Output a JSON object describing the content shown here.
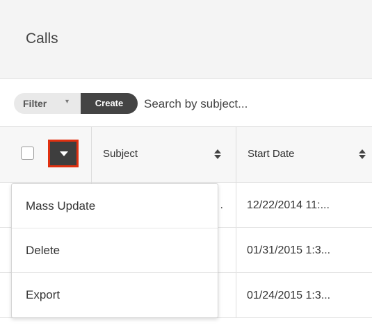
{
  "header": {
    "title": "Calls"
  },
  "filterbar": {
    "filter_label": "Filter",
    "filter_caret": "▾",
    "create_label": "Create",
    "search_placeholder": "Search by subject..."
  },
  "table": {
    "columns": [
      {
        "label": "Subject"
      },
      {
        "label": "Start Date"
      }
    ],
    "rows": [
      {
        "subject": ".",
        "start_date": "12/22/2014 11:..."
      },
      {
        "subject": "",
        "start_date": "01/31/2015 1:3..."
      },
      {
        "subject": "",
        "start_date": "01/24/2015 1:3..."
      }
    ]
  },
  "mass_actions_menu": {
    "items": [
      {
        "label": "Mass Update"
      },
      {
        "label": "Delete"
      },
      {
        "label": "Export"
      }
    ]
  },
  "colors": {
    "header_bg": "#f4f4f4",
    "create_bg": "#444444",
    "toggle_bg": "#3e3e3e",
    "highlight_border": "#e03010"
  }
}
